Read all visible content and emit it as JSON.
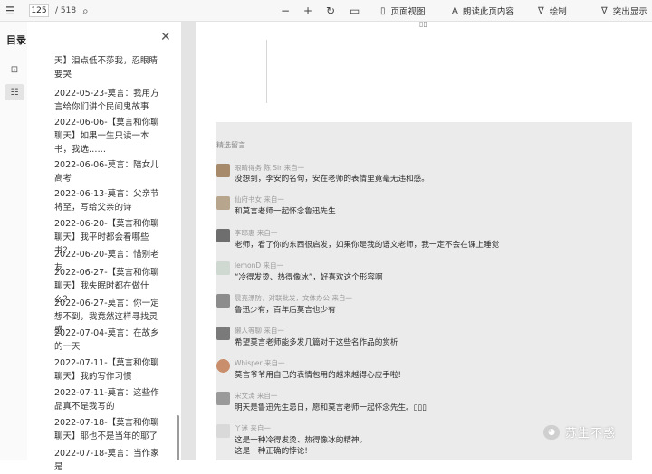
{
  "toolbar": {
    "page_current": "125",
    "page_total": "/ 518",
    "page_view": "页面视图",
    "read_aloud": "朗读此页内容",
    "draw": "绘制",
    "highlight": "突出显示"
  },
  "toc": {
    "title": "目录",
    "items": [
      "天】泪点低不莎我，忍眼睛要哭",
      "2022-05-23-莫言：我用方言给你们讲个民间鬼故事",
      "2022-06-06-【莫言和你聊聊天】如果一生只读一本书，我选……",
      "2022-06-06-莫言：陪女儿高考",
      "2022-06-13-莫言：父亲节将至，写给父亲的诗",
      "2022-06-20-【莫言和你聊聊天】我平时都会看哪些书？",
      "2022-06-20-莫言：惜别老友",
      "2022-06-27-【莫言和你聊聊天】我失眠时都在做什么？",
      "2022-06-27-莫言：你一定想不到，我竟然这样寻找灵感",
      "2022-07-04-莫言：在故乡的一天",
      "2022-07-11-【莫言和你聊聊天】我的写作习惯",
      "2022-07-11-莫言：这些作品真不是我写的",
      "2022-07-18-【莫言和你聊聊天】耶也不是当年的耶了",
      "2022-07-18-莫言：当作家是"
    ]
  },
  "content": {
    "top_mark": "▯▯",
    "section_title": "精选留言",
    "comments": [
      {
        "name": "眼睛得务 陈 Sir 来自一",
        "lines": [
          "没想到，李安的名句，安在老师的表情里竟毫无违和感。"
        ]
      },
      {
        "name": "仙府书女 来自一",
        "lines": [
          "和莫言老师一起怀念鲁迅先生"
        ]
      },
      {
        "name": "李耶惠 来自一",
        "lines": [
          "老师，看了你的东西很启发，如果你是我的语文老师，我一定不会在课上睡觉"
        ]
      },
      {
        "name": "lemonD 来自一",
        "lines": [
          "“冷得发烫、热得像冰”，好喜欢这个形容啊"
        ]
      },
      {
        "name": "晨亮漂防，对联批发，文体办公 来自一",
        "lines": [
          "鲁迅少有，百年后莫言也少有"
        ]
      },
      {
        "name": "懒人等聊 来自一",
        "lines": [
          "希望莫言老师能多发几篇对于这些名作品的赏析"
        ]
      },
      {
        "name": "Whisper 来自一",
        "lines": [
          "莫言爷爷用自己的表情包用的越来越得心应手啦!"
        ]
      },
      {
        "name": "宋文涛 来自一",
        "lines": [
          "明天是鲁迅先生忌日，愿和莫言老师一起怀念先生。▯▯▯"
        ]
      },
      {
        "name": "丫迷 来自一",
        "lines": [
          "这是一种冷得发烫、热得像冰的精神。",
          "这是一种正确的悖论!"
        ]
      }
    ],
    "watermark": "苏生不惑"
  }
}
